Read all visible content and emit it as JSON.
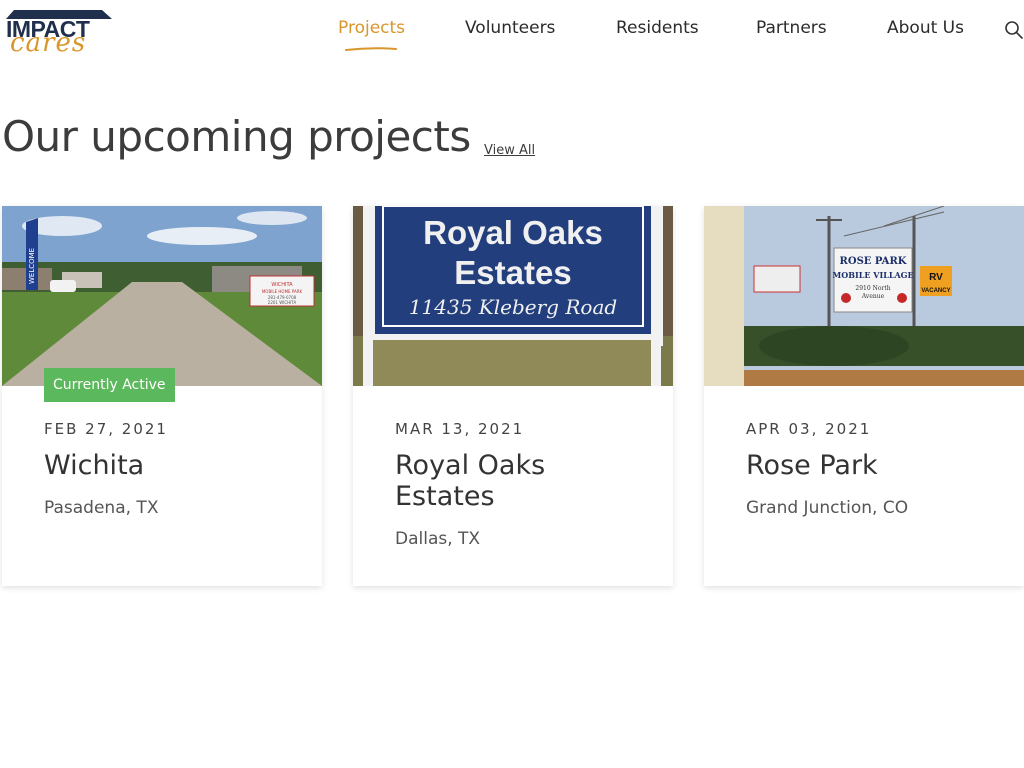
{
  "brand": {
    "logo_top": "IMPACT",
    "logo_bottom": "cares",
    "accent": "#d9962b",
    "navy": "#1f2f4c"
  },
  "nav": {
    "items": [
      {
        "label": "Projects",
        "active": true
      },
      {
        "label": "Volunteers"
      },
      {
        "label": "Residents"
      },
      {
        "label": "Partners"
      },
      {
        "label": "About Us"
      }
    ],
    "search_icon": "search-icon"
  },
  "section": {
    "heading": "Our upcoming projects",
    "view_all": "View All"
  },
  "cards": [
    {
      "badge": "Currently Active",
      "badge_color": "#5cb85c",
      "date": "FEB 27, 2021",
      "title": "Wichita",
      "location": "Pasadena, TX",
      "image_sign": [
        "WELCOME",
        "WICHITA",
        "MOBILE HOME PARK",
        "281-479-0708",
        "2201 WICHITA"
      ]
    },
    {
      "date": "MAR 13, 2021",
      "title": "Royal Oaks Estates",
      "location": "Dallas, TX",
      "image_sign": [
        "Royal Oaks",
        "Estates",
        "11435 Kleberg Road"
      ]
    },
    {
      "date": "APR 03, 2021",
      "title": "Rose Park",
      "location": "Grand Junction, CO",
      "image_sign": [
        "ROSE PARK",
        "MOBILE VILLAGE",
        "2910 North",
        "Avenue",
        "RV",
        "VACANCY"
      ]
    }
  ]
}
